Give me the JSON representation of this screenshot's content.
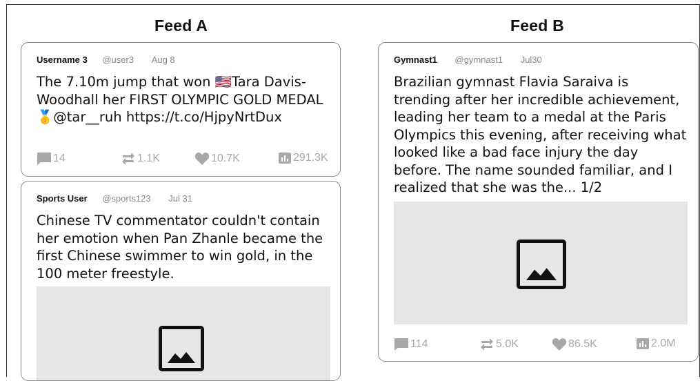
{
  "feeds": [
    {
      "title": "Feed A",
      "posts": [
        {
          "username": "Username 3",
          "handle": "@user3",
          "date": "Aug 8",
          "text": "The 7.10m jump that won 🇺🇸Tara Davis-Woodhall her FIRST OLYMPIC GOLD MEDAL 🥇@tar__ruh https://t.co/HjpyNrtDux",
          "replies": "14",
          "retweets": "1.1K",
          "likes": "10.7K",
          "views": "291.3K",
          "has_media": false
        },
        {
          "username": "Sports User",
          "handle": "@sports123",
          "date": "Jul 31",
          "text": "Chinese TV commentator couldn't contain her emotion when Pan Zhanle became the first Chinese swimmer to win gold, in the 100 meter freestyle.",
          "has_media": true,
          "media_icon": "image-placeholder-icon"
        }
      ]
    },
    {
      "title": "Feed B",
      "posts": [
        {
          "username": "Gymnast1",
          "handle": "@gymnast1",
          "date": "Jul30",
          "text": "Brazilian gymnast Flavia Saraiva is trending after her incredible achievement, leading her team to a medal at the Paris Olympics this evening, after receiving what looked like a bad face injury the day before. The name sounded familiar, and I realized that she was the... 1/2",
          "replies": "114",
          "retweets": "5.0K",
          "likes": "86.5K",
          "views": "2.0M",
          "has_media": true,
          "media_icon": "image-placeholder-icon"
        }
      ]
    }
  ],
  "icons": {
    "reply": "comment-icon",
    "retweet": "retweet-icon",
    "like": "heart-icon",
    "views": "bar-chart-icon"
  },
  "colors": {
    "muted_text": "#888888",
    "action_gray": "#a8a8a8",
    "media_bg": "#e6e6e6",
    "card_border": "#8a8a8a"
  }
}
